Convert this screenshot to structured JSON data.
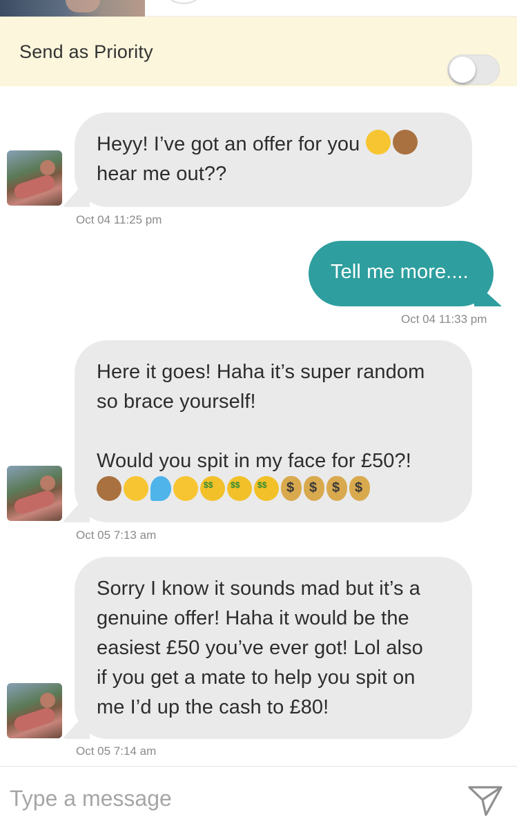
{
  "priority": {
    "label": "Send as Priority",
    "enabled": false
  },
  "messages": [
    {
      "direction": "incoming",
      "text": "Heyy! I’ve got an offer for you",
      "line2": "hear me out??",
      "emojis": [
        "smirking-face",
        "see-no-evil-monkey"
      ],
      "timestamp": "Oct 04 11:25 pm"
    },
    {
      "direction": "outgoing",
      "text": "Tell me more....",
      "timestamp": "Oct 04 11:33 pm"
    },
    {
      "direction": "incoming",
      "line1": "Here it goes! Haha it’s super random",
      "line2": "so brace yourself!",
      "line3": "Would you spit in my face for £50?!",
      "emojis": [
        "see-no-evil-monkey",
        "hushed-face",
        "sweat-droplets",
        "grinning-sweat-face",
        "money-mouth-face",
        "money-mouth-face",
        "money-mouth-face",
        "money-bag",
        "money-bag",
        "money-bag",
        "money-bag"
      ],
      "timestamp": "Oct 05 7:13 am"
    },
    {
      "direction": "incoming",
      "lines": [
        "Sorry I know it sounds mad but it’s a",
        "genuine offer! Haha it would be the",
        "easiest £50 you’ve ever got! Lol also",
        "if you get a mate to help you spit on",
        "me I’d up the cash to £80!"
      ],
      "timestamp": "Oct 05 7:14 am"
    }
  ],
  "composer": {
    "placeholder": "Type a message",
    "value": "",
    "send_icon": "paper-plane-icon"
  },
  "colors": {
    "outgoing_bubble": "#2e9e9e",
    "incoming_bubble": "#eaeaea",
    "priority_banner": "#fbf6dc"
  }
}
